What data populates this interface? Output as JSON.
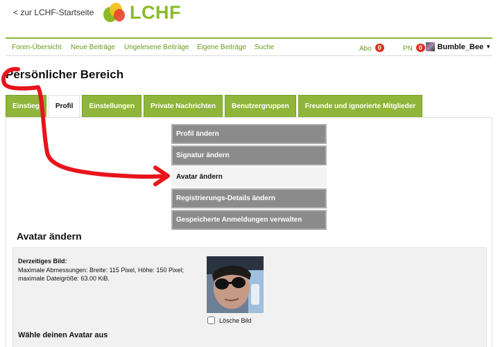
{
  "header": {
    "back_link": "< zur LCHF-Startseite",
    "logo_text": "LCHF"
  },
  "nav": {
    "items": [
      "Foren-Übersicht",
      "Neue Beiträge",
      "Ungelesene Beiträge",
      "Eigene Beiträge",
      "Suche"
    ],
    "abo_label": "Abo",
    "abo_count": "0",
    "pn_label": "PN",
    "pn_count": "0",
    "username": "Bumble_Bee",
    "accent": "#8fb53a",
    "badge_color": "#e0301e"
  },
  "page_title": "Persönlicher Bereich",
  "tabs": [
    {
      "label": "Einstieg",
      "active": false
    },
    {
      "label": "Profil",
      "active": true
    },
    {
      "label": "Einstellungen",
      "active": false
    },
    {
      "label": "Private Nachrichten",
      "active": false
    },
    {
      "label": "Benutzergruppen",
      "active": false
    },
    {
      "label": "Freunde und ignorierte Mitglieder",
      "active": false
    }
  ],
  "submenu": [
    {
      "label": "Profil ändern",
      "active": false
    },
    {
      "label": "Signatur ändern",
      "active": false
    },
    {
      "label": "Avatar ändern",
      "active": true
    },
    {
      "label": "Registrierungs-Details ändern",
      "active": false
    },
    {
      "label": "Gespeicherte Anmeldungen verwalten",
      "active": false
    }
  ],
  "avatar_section": {
    "title": "Avatar ändern",
    "current_label": "Derzeitiges Bild:",
    "current_desc": "Maximale Abmessungen: Breite: 115 Pixel, Höhe: 150 Pixel; maximale Dateigröße: 63.00 KiB.",
    "delete_label": "Lösche Bild",
    "choose_label": "Wähle deinen Avatar aus"
  },
  "annotation_color": "#e8141c"
}
